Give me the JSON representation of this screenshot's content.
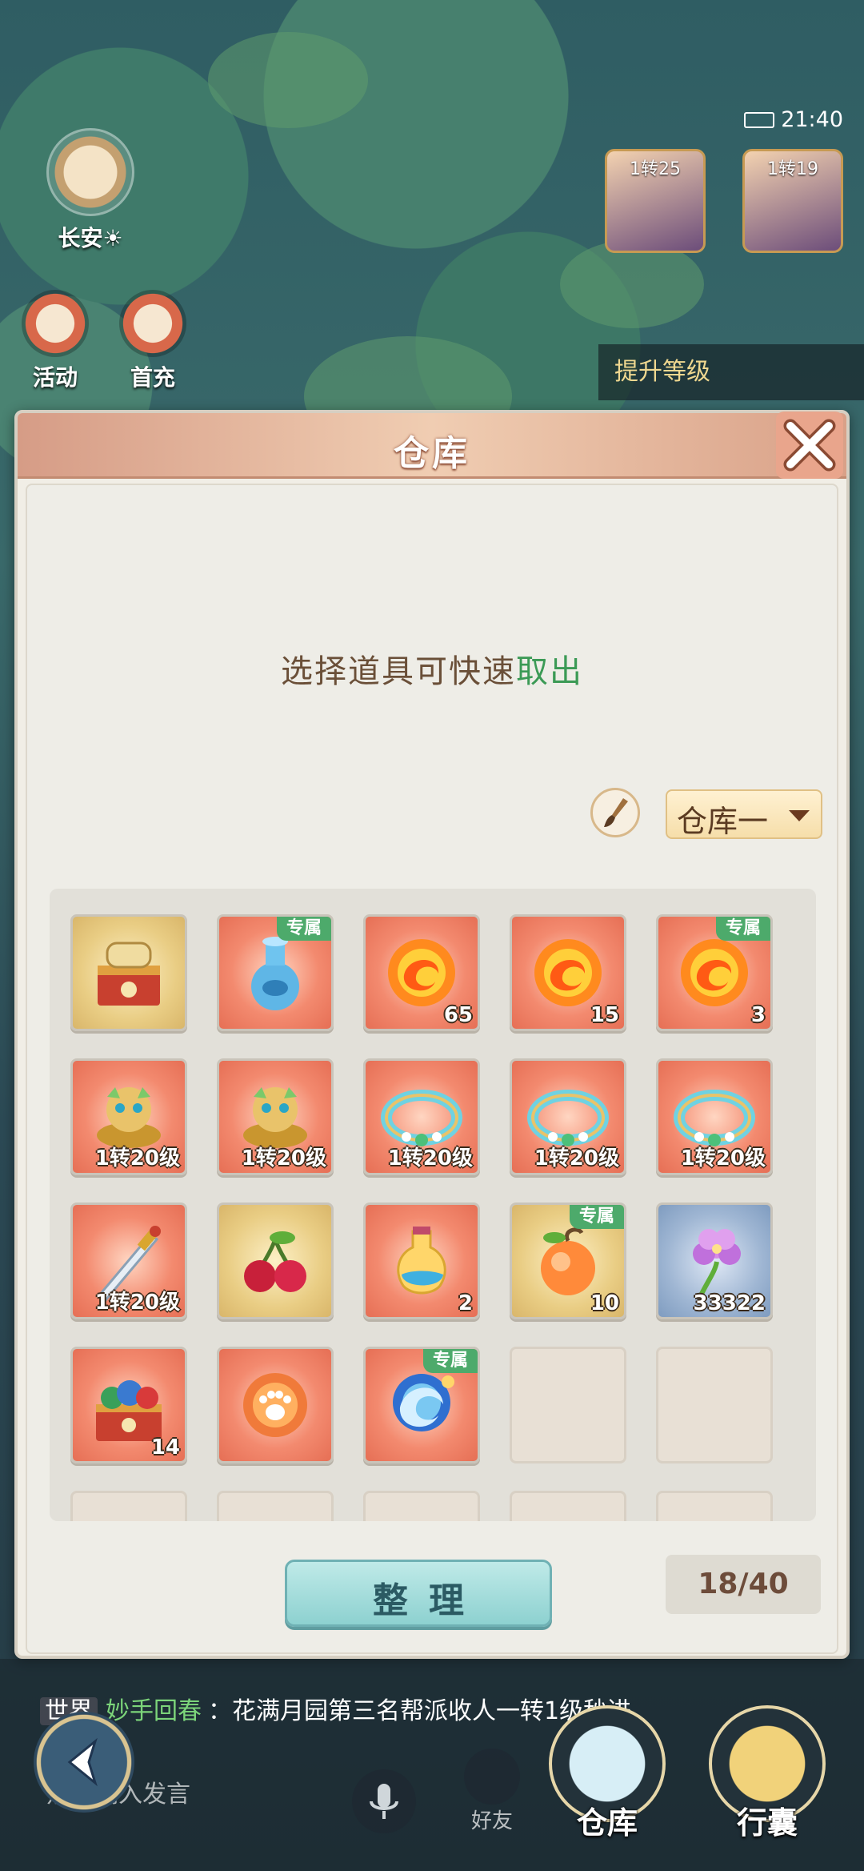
{
  "status": {
    "time": "21:40"
  },
  "hud": {
    "city_label": "长安☀",
    "activity_label": "活动",
    "first_recharge_label": "首充",
    "pet_level": "1转25",
    "player_level": "1转19",
    "quest_text": "提升等级"
  },
  "panel": {
    "title": "仓库",
    "hint_prefix": "选择道具可快速",
    "hint_accent": "取出",
    "warehouse_select": "仓库一",
    "sort_label": "整理",
    "capacity": "18/40",
    "exclusive_tag": "专属"
  },
  "items": [
    {
      "icon": "scroll-chest-icon",
      "bg": "gold",
      "count": "",
      "exclusive": false
    },
    {
      "icon": "spirit-vase-icon",
      "bg": "red",
      "count": "",
      "exclusive": true
    },
    {
      "icon": "fire-orb-icon",
      "bg": "red",
      "count": "65",
      "exclusive": false
    },
    {
      "icon": "fire-orb-icon",
      "bg": "red",
      "count": "15",
      "exclusive": false
    },
    {
      "icon": "fire-orb-icon",
      "bg": "red",
      "count": "3",
      "exclusive": true
    },
    {
      "icon": "jade-beast-icon",
      "bg": "red",
      "count": "1转20级",
      "exclusive": false
    },
    {
      "icon": "jade-beast-icon",
      "bg": "red",
      "count": "1转20级",
      "exclusive": false
    },
    {
      "icon": "jade-bracelet-icon",
      "bg": "red",
      "count": "1转20级",
      "exclusive": false
    },
    {
      "icon": "jade-bracelet-icon",
      "bg": "red",
      "count": "1转20级",
      "exclusive": false
    },
    {
      "icon": "jade-bracelet-icon",
      "bg": "red",
      "count": "1转20级",
      "exclusive": false
    },
    {
      "icon": "sword-icon",
      "bg": "red",
      "count": "1转20级",
      "exclusive": false
    },
    {
      "icon": "cherry-icon",
      "bg": "gold",
      "count": "",
      "exclusive": false
    },
    {
      "icon": "potion-icon",
      "bg": "red",
      "count": "2",
      "exclusive": false
    },
    {
      "icon": "peach-icon",
      "bg": "gold",
      "count": "10",
      "exclusive": true
    },
    {
      "icon": "purple-flower-icon",
      "bg": "blue",
      "count": "33322",
      "exclusive": false
    },
    {
      "icon": "gem-chest-icon",
      "bg": "red",
      "count": "14",
      "exclusive": false
    },
    {
      "icon": "paw-orb-icon",
      "bg": "red",
      "count": "",
      "exclusive": false
    },
    {
      "icon": "blue-spirit-orb-icon",
      "bg": "red",
      "count": "",
      "exclusive": true
    }
  ],
  "chat": {
    "line1_channel": "世界",
    "line1_name": "妙手回春",
    "line1_text": "：花满月园第三名帮派收人一转1级秒进",
    "input_placeholder": "点击输入发言",
    "friends_label": "好友"
  },
  "nav": {
    "warehouse_label": "仓库",
    "bag_label": "行囊"
  },
  "colors": {
    "accent_green": "#3b9a55",
    "exclusive_tag": "#4daa6b",
    "sort_button": "#8dd1d0"
  }
}
